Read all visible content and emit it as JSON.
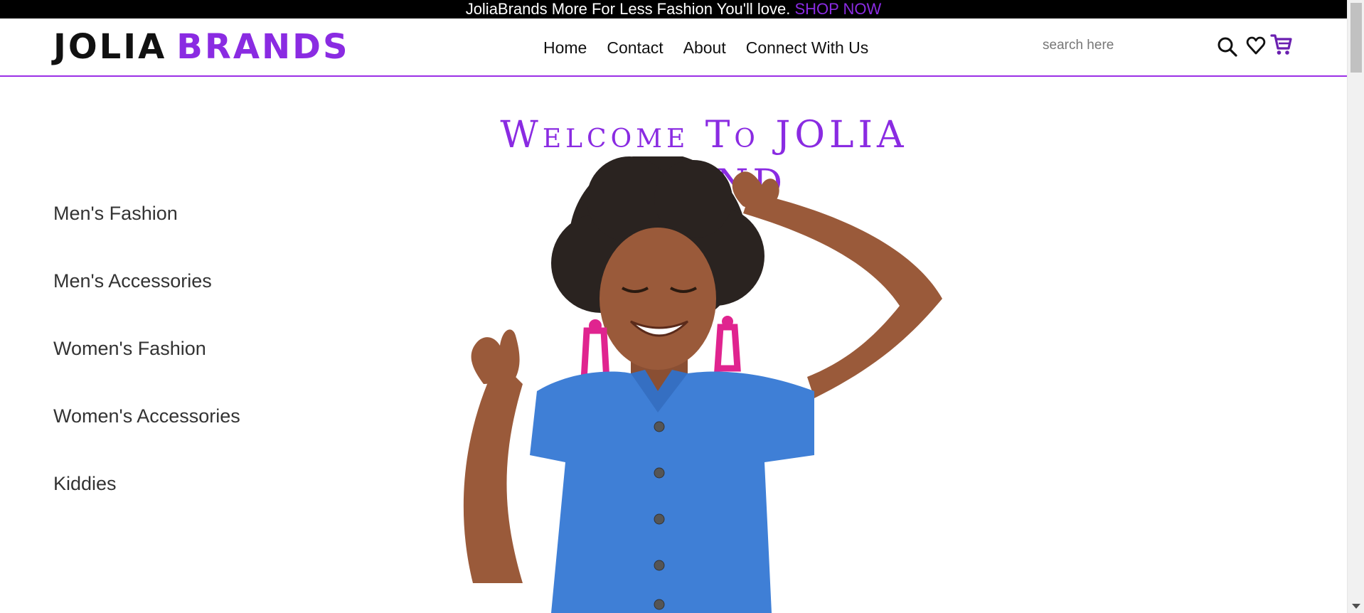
{
  "promo": {
    "text": "JoliaBrands More For Less Fashion You'll love.",
    "cta": "SHOP NOW"
  },
  "header": {
    "logo_part1": "JOLIA",
    "logo_part2": "BRANDS",
    "nav": [
      "Home",
      "Contact",
      "About",
      "Connect With Us"
    ],
    "search": {
      "placeholder": "search here",
      "value": ""
    },
    "icons": [
      "search-icon",
      "heart-icon",
      "cart-icon"
    ]
  },
  "main": {
    "welcome": "Welcome To JOLIA BRAND",
    "categories": [
      "Men's Fashion",
      "Men's Accessories",
      "Women's Fashion",
      "Women's Accessories",
      "Kiddies"
    ]
  },
  "colors": {
    "accent": "#8a2be2",
    "promo_bg": "#000000",
    "dress": "#3f7fd6",
    "earrings": "#e0248f",
    "skin": "#9a5a3a",
    "hair": "#2a2320"
  }
}
